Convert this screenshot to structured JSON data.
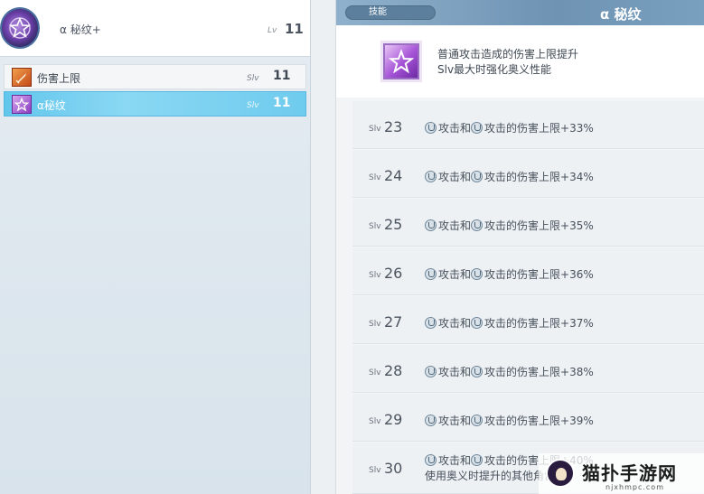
{
  "left_panel": {
    "header": {
      "skill_name": "α 秘纹+",
      "lv_label": "Lv",
      "lv_value": "11"
    },
    "items": [
      {
        "label": "伤害上限",
        "slv_label": "Slv",
        "slv": "11",
        "icon": "sword-icon",
        "selected": false
      },
      {
        "label": "α秘纹",
        "slv_label": "Slv",
        "slv": "11",
        "icon": "star-icon",
        "selected": true
      }
    ]
  },
  "right_panel": {
    "tab_label": "技能",
    "title": "α 秘纹",
    "description": {
      "line1": "普通攻击造成的伤害上限提升",
      "line2": "Slv最大时强化奥义性能",
      "icon": "star-icon"
    },
    "rows": [
      {
        "slv_label": "Slv",
        "slv": "23",
        "text_a": "攻击和",
        "text_b": "攻击的伤害上限+33%"
      },
      {
        "slv_label": "Slv",
        "slv": "24",
        "text_a": "攻击和",
        "text_b": "攻击的伤害上限+34%"
      },
      {
        "slv_label": "Slv",
        "slv": "25",
        "text_a": "攻击和",
        "text_b": "攻击的伤害上限+35%"
      },
      {
        "slv_label": "Slv",
        "slv": "26",
        "text_a": "攻击和",
        "text_b": "攻击的伤害上限+36%"
      },
      {
        "slv_label": "Slv",
        "slv": "27",
        "text_a": "攻击和",
        "text_b": "攻击的伤害上限+37%"
      },
      {
        "slv_label": "Slv",
        "slv": "28",
        "text_a": "攻击和",
        "text_b": "攻击的伤害上限+38%"
      },
      {
        "slv_label": "Slv",
        "slv": "29",
        "text_a": "攻击和",
        "text_b": "攻击的伤害上限+39%"
      },
      {
        "slv_label": "Slv",
        "slv": "30",
        "text_a": "攻击和",
        "text_b": "攻击的伤害上限+40%",
        "text_line2": "使用奥义时提升的其他角色"
      }
    ]
  },
  "watermark": {
    "text": "猫扑手游网",
    "url": "njxhmpc.com"
  },
  "colors": {
    "selected_item": "#62c6ec",
    "header_bar": "#7aa0bf",
    "tab_pill": "#5c7f9d"
  }
}
